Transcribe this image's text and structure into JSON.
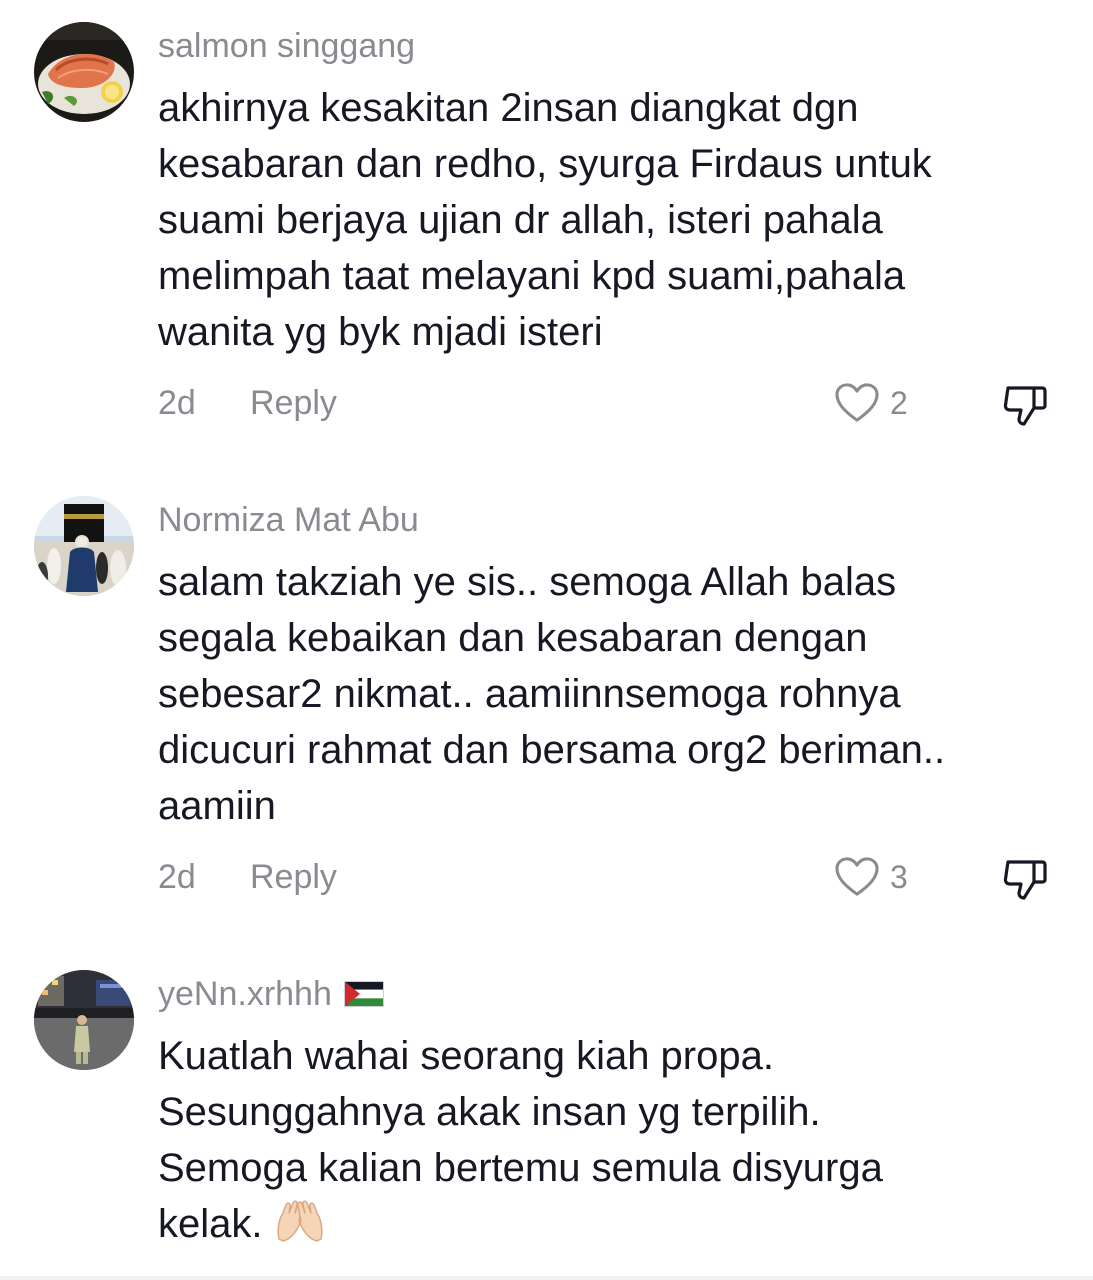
{
  "comments": [
    {
      "username": "salmon singgang",
      "avatar": "salmon-dish-photo",
      "lines": [
        "akhirnya kesakitan 2insan diangkat dgn",
        "kesabaran dan redho, syurga Firdaus untuk",
        "suami berjaya ujian dr allah, isteri pahala",
        "melimpah taat melayani kpd suami,pahala",
        "wanita yg byk mjadi isteri"
      ],
      "time": "2d",
      "reply_label": "Reply",
      "likes": "2"
    },
    {
      "username": "Normiza Mat Abu",
      "avatar": "kaaba-photo",
      "lines": [
        "salam takziah ye sis.. semoga Allah balas",
        "segala kebaikan dan kesabaran dengan",
        "sebesar2 nikmat.. aamiinnsemoga rohnya",
        "dicucuri rahmat dan bersama org2 beriman..",
        "aamiin"
      ],
      "time": "2d",
      "reply_label": "Reply",
      "likes": "3"
    },
    {
      "username": "yeNn.xrhhh",
      "username_flag": "palestine-flag",
      "avatar": "street-night-photo",
      "lines": [
        "Kuatlah wahai seorang kiah propa.",
        "Sesunggahnya akak insan yg terpilih.",
        "Semoga kalian bertemu semula disyurga",
        "kelak."
      ],
      "trailing_emoji": "raising-hands-emoji"
    }
  ],
  "icons": {
    "like": "heart-outline-icon",
    "dislike": "thumbs-down-outline-icon"
  },
  "colors": {
    "text": "#161823",
    "secondary": "#8a8b91"
  }
}
